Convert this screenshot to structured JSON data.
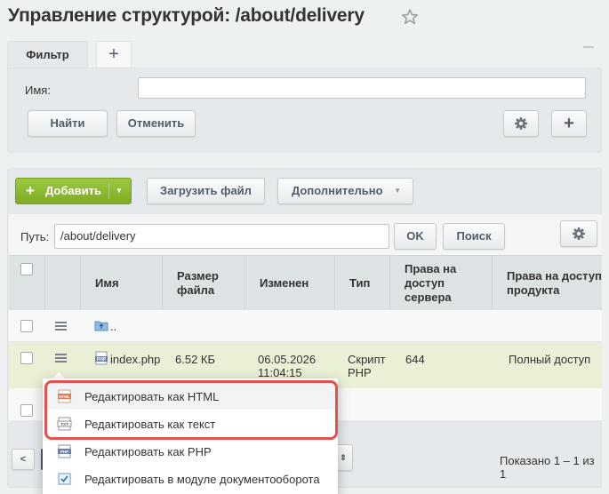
{
  "header": {
    "title": "Управление структурой: /about/delivery"
  },
  "filter": {
    "tab_label": "Фильтр",
    "tab_add": "+",
    "name_label": "Имя:",
    "name_value": "",
    "find_label": "Найти",
    "cancel_label": "Отменить",
    "add_label": "+"
  },
  "toolbar": {
    "add_label": "Добавить",
    "add_plus": "+",
    "add_caret": "▼",
    "upload_label": "Загрузить файл",
    "more_label": "Дополнительно",
    "more_caret": "▼"
  },
  "path": {
    "label": "Путь:",
    "value": "/about/delivery",
    "ok_label": "OK",
    "search_label": "Поиск"
  },
  "table": {
    "columns": [
      "Имя",
      "Размер файла",
      "Изменен",
      "Тип",
      "Права на доступ сервера",
      "Права на доступ продукта"
    ],
    "rows": [
      {
        "name": "..",
        "size": "",
        "modified": "",
        "type": "",
        "server_access": "",
        "product_access": ""
      },
      {
        "name": "index.php",
        "size": "6.52 КБ",
        "modified": "06.05.2026 11:04:15",
        "type": "Скрипт PHP",
        "server_access": "644",
        "product_access": "Полный доступ"
      }
    ]
  },
  "footer": {
    "prev": "<",
    "page_size_toggle": "⇕",
    "shown": "Показано 1 – 1 из 1"
  },
  "context_menu": {
    "items": [
      {
        "label": "Редактировать как HTML",
        "icon": "html-icon",
        "badge": "HTML"
      },
      {
        "label": "Редактировать как текст",
        "icon": "txt-icon",
        "badge": "TXT"
      },
      {
        "label": "Редактировать как PHP",
        "icon": "php-icon",
        "badge": "PHP"
      },
      {
        "label": "Редактировать в модуле документооборота",
        "icon": "workflow-icon"
      }
    ]
  },
  "colors": {
    "accent_green": "#86b12f",
    "highlight_red": "#e2534f",
    "selected_row": "#eaf0d5"
  }
}
